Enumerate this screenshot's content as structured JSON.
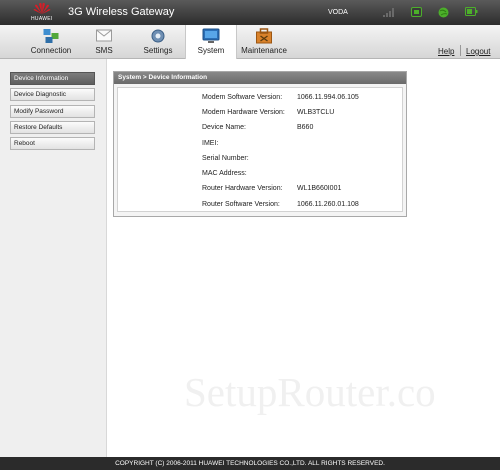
{
  "header": {
    "brand": "HUAWEI",
    "title": "3G Wireless Gateway",
    "operator": "VODA",
    "status_icons": [
      "signal-strength-icon",
      "sms-indicator-icon",
      "internet-connected-icon",
      "battery-icon"
    ]
  },
  "nav": {
    "tabs": [
      {
        "label": "Connection",
        "icon": "connection-icon"
      },
      {
        "label": "SMS",
        "icon": "envelope-icon"
      },
      {
        "label": "Settings",
        "icon": "settings-icon"
      },
      {
        "label": "System",
        "icon": "monitor-icon",
        "active": true
      },
      {
        "label": "Maintenance",
        "icon": "toolbox-icon"
      }
    ],
    "help_label": "Help",
    "logout_label": "Logout"
  },
  "sidebar": {
    "items": [
      {
        "label": "Device Information",
        "active": true
      },
      {
        "label": "Device Diagnostic"
      },
      {
        "label": "Modify Password"
      },
      {
        "label": "Restore Defaults"
      },
      {
        "label": "Reboot"
      }
    ]
  },
  "panel": {
    "title": "System > Device Information",
    "rows": [
      {
        "label": "Modem Software Version:",
        "value": "1066.11.994.06.105"
      },
      {
        "label": "Modem Hardware Version:",
        "value": "WLB3TCLU"
      },
      {
        "label": "Device Name:",
        "value": "B660"
      },
      {
        "label": "IMEI:",
        "value": ""
      },
      {
        "label": "Serial Number:",
        "value": ""
      },
      {
        "label": "MAC Address:",
        "value": ""
      },
      {
        "label": "Router Hardware Version:",
        "value": "WL1B660I001"
      },
      {
        "label": "Router Software Version:",
        "value": "1066.11.260.01.108"
      }
    ]
  },
  "watermark": "SetupRouter.co",
  "footer": "COPYRIGHT (C) 2006-2011 HUAWEI TECHNOLOGIES CO.,LTD. ALL RIGHTS RESERVED.",
  "colors": {
    "header_bg": "#2c2c2c",
    "nav_bg": "#e6e6e6",
    "sidebar_active": "#6b6b6b",
    "panel_header": "#787878",
    "footer_bg": "#2b2b2b",
    "huawei_red": "#d71e28",
    "status_green": "#4caf2a"
  }
}
